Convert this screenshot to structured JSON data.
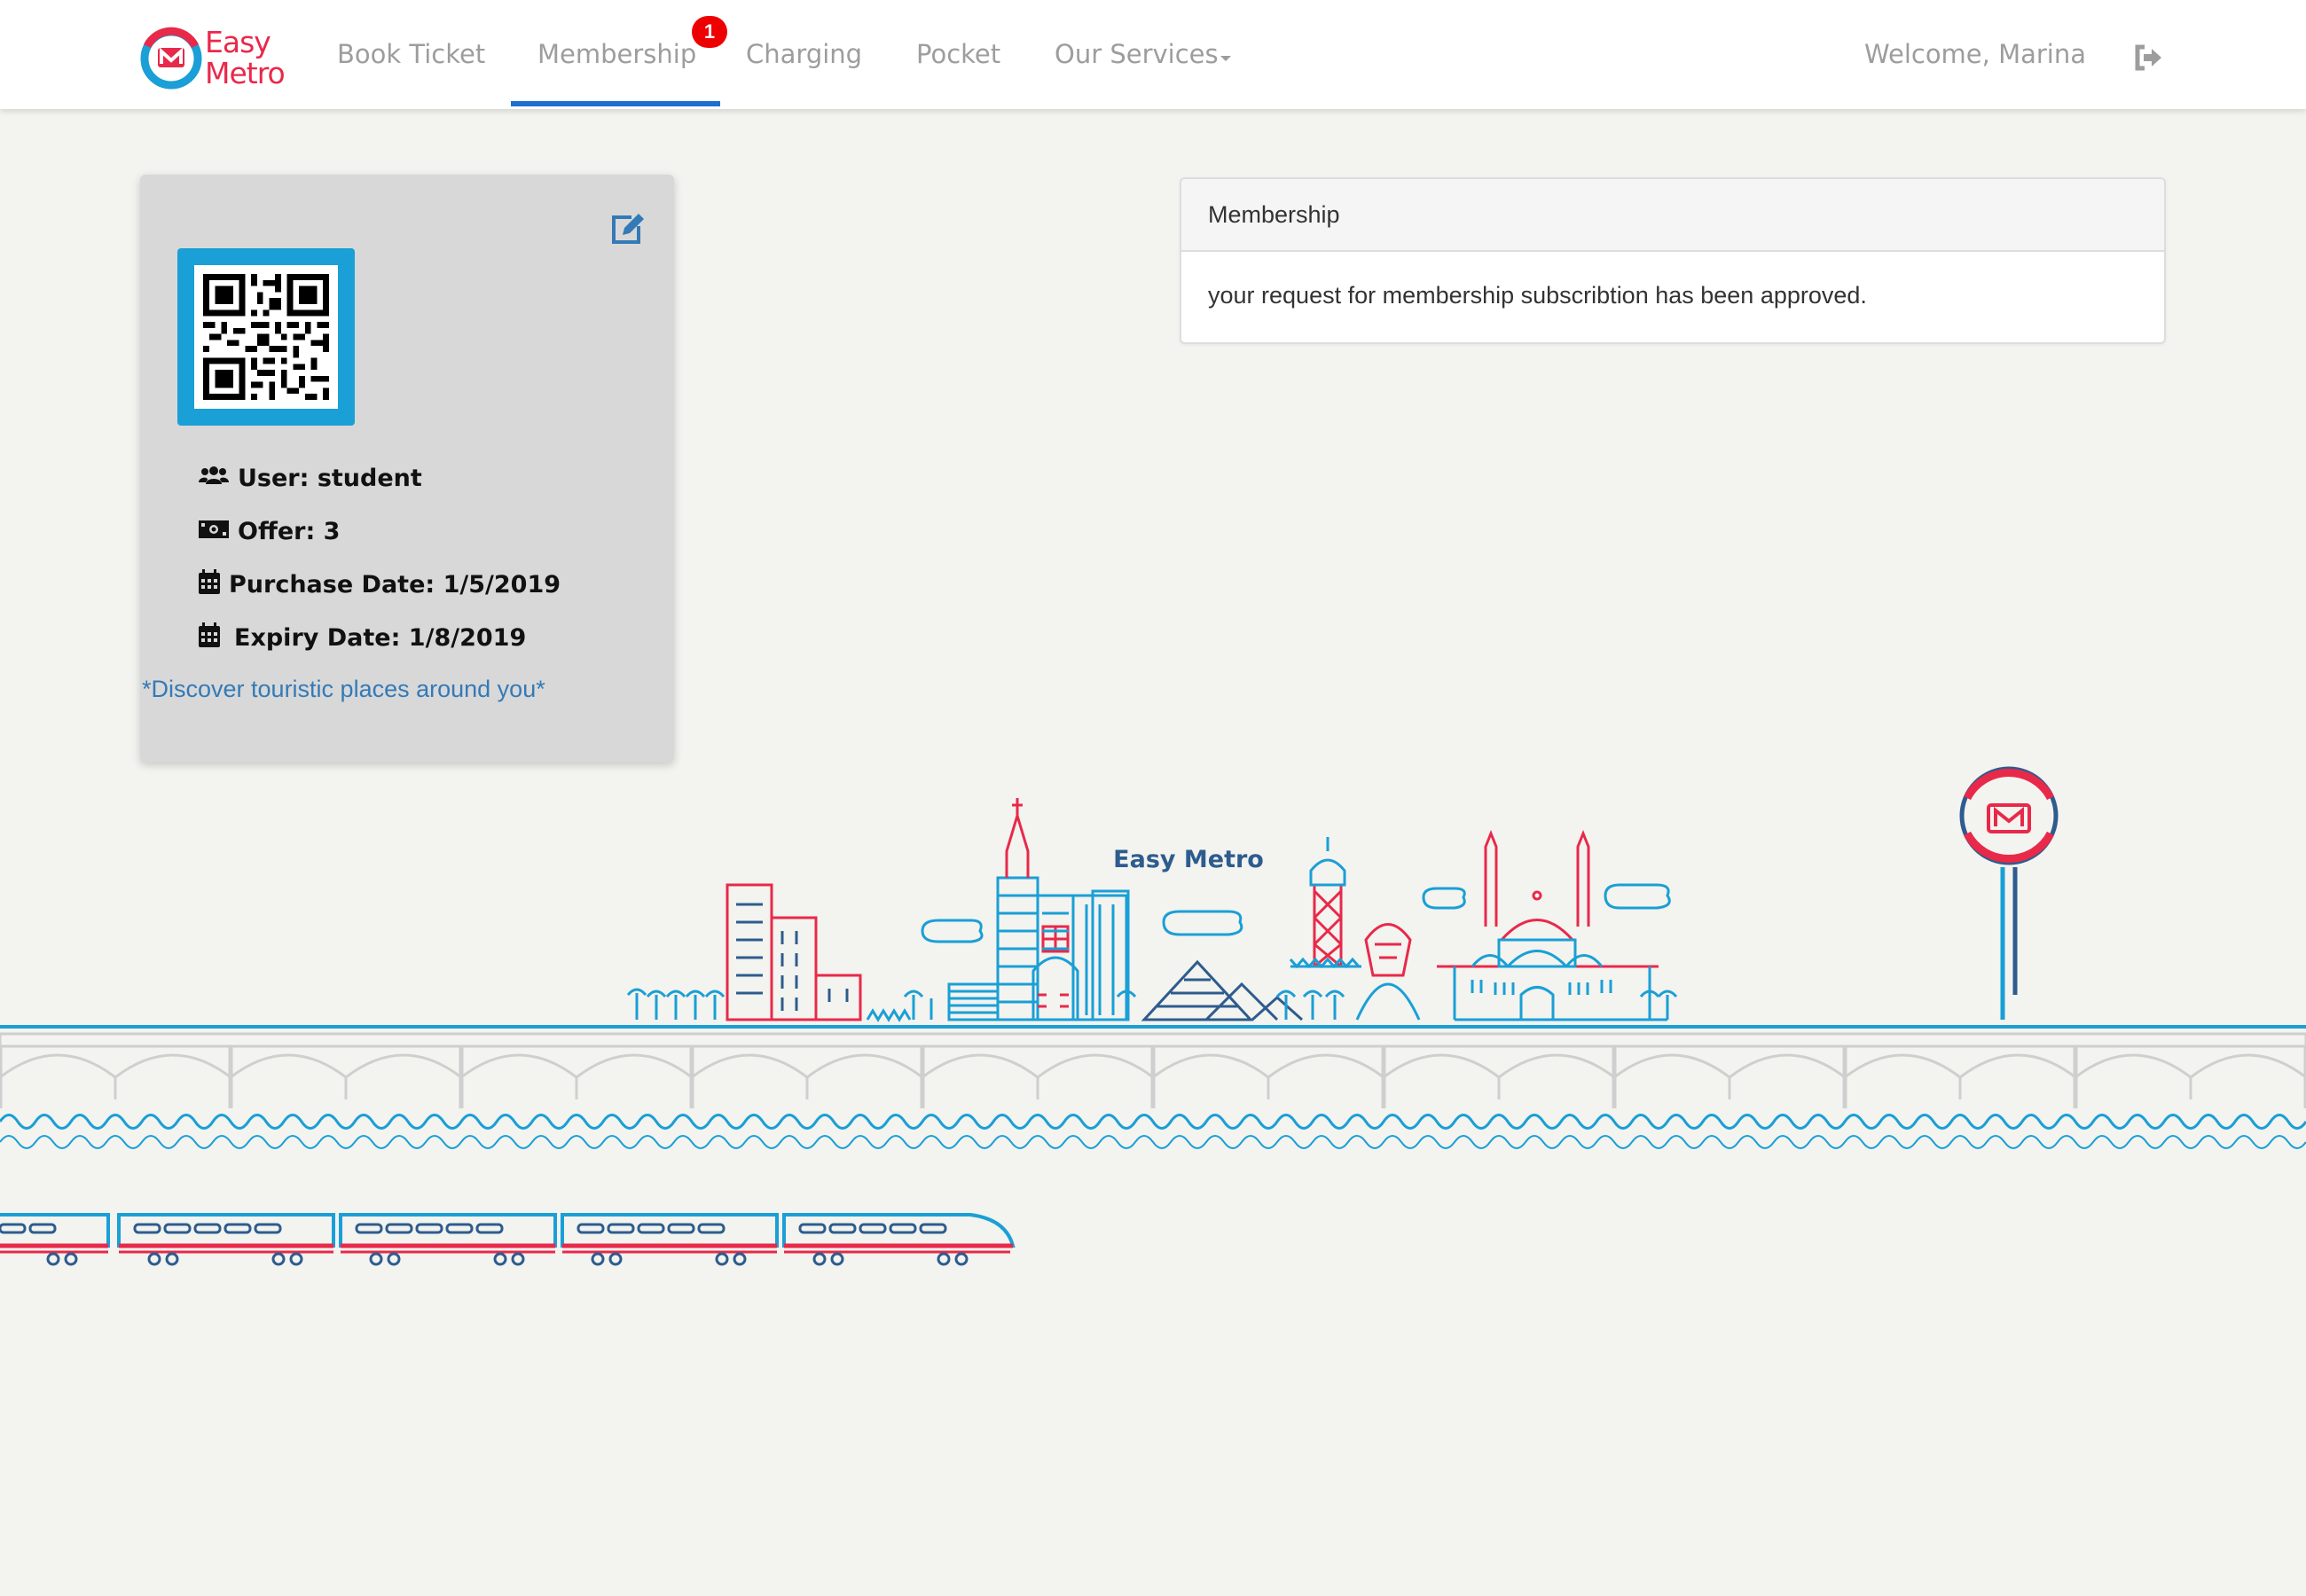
{
  "app": {
    "logo_line1": "Easy",
    "logo_line2": "Metro"
  },
  "nav": {
    "items": [
      {
        "label": "Book Ticket"
      },
      {
        "label": "Membership",
        "badge": "1",
        "active": true
      },
      {
        "label": "Charging"
      },
      {
        "label": "Pocket"
      },
      {
        "label": "Our Services"
      }
    ],
    "welcome": "Welcome, Marina",
    "logout_icon": "sign-out-icon"
  },
  "profile": {
    "edit_icon": "edit-icon",
    "qr_icon": "qr-code",
    "user_label": "User: student",
    "offer_label": "Offer: 3",
    "purchase_label": "Purchase Date: 1/5/2019",
    "expiry_label": "Expiry Date: 1/8/2019",
    "discover_link": "*Discover touristic places around you*"
  },
  "membership_panel": {
    "heading": "Membership",
    "message": "your request for membership subscribtion has been approved."
  },
  "illustration": {
    "caption": "Easy Metro"
  },
  "colors": {
    "accent_blue": "#1a9fd6",
    "brand_red": "#e8294a",
    "nav_active": "#1f6fd1",
    "badge_red": "#ee0000",
    "link_blue": "#337ab7",
    "page_bg": "#f3f3ef"
  }
}
